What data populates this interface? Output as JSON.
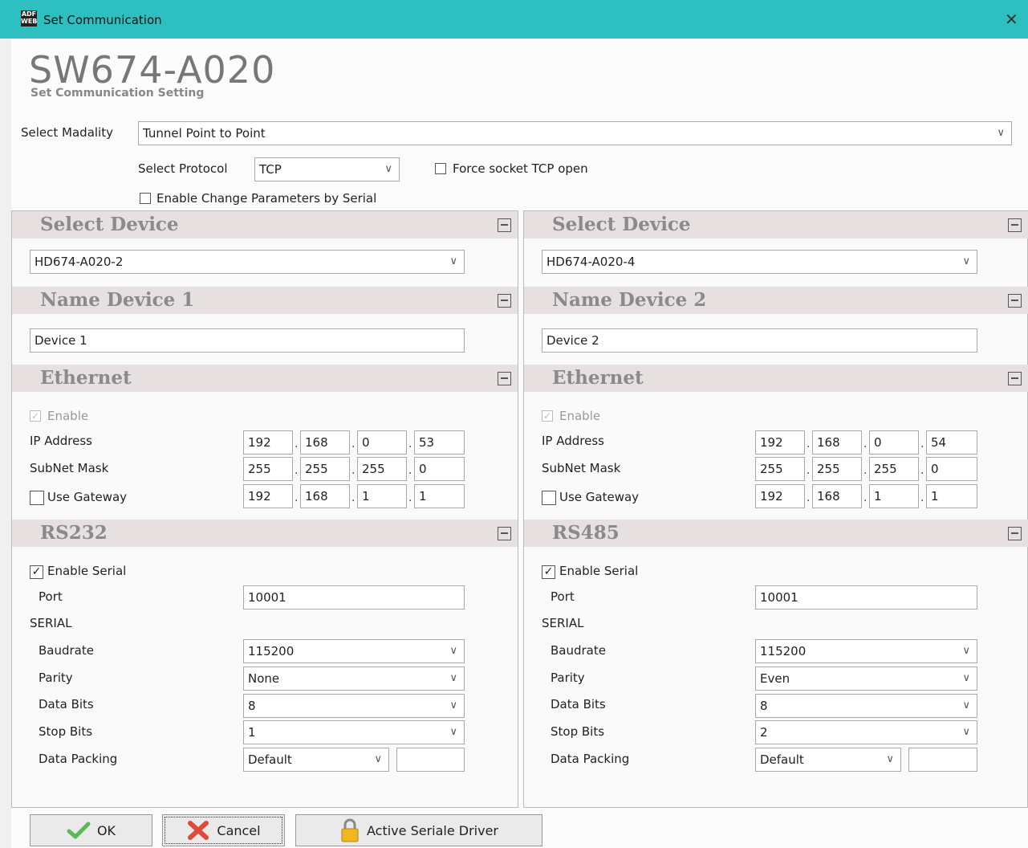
{
  "window": {
    "title": "Set Communication",
    "logo_text": "ADF WEB"
  },
  "header": {
    "title": "SW674-A020",
    "subtitle": "Set Communication Setting"
  },
  "modality": {
    "label": "Select Madality",
    "value": "Tunnel Point to Point"
  },
  "protocol": {
    "label": "Select Protocol",
    "value": "TCP",
    "force_label": "Force socket TCP open",
    "enable_change_label": "Enable Change Parameters by Serial"
  },
  "left": {
    "select_device": {
      "title": "Select Device",
      "value": "HD674-A020-2"
    },
    "name_device": {
      "title": "Name Device 1",
      "value": "Device 1"
    },
    "ethernet": {
      "title": "Ethernet",
      "enable_label": "Enable",
      "ip_label": "IP Address",
      "ip": [
        "192",
        "168",
        "0",
        "53"
      ],
      "mask_label": "SubNet Mask",
      "mask": [
        "255",
        "255",
        "255",
        "0"
      ],
      "gw_label": "Use Gateway",
      "gw": [
        "192",
        "168",
        "1",
        "1"
      ]
    },
    "serial_section": {
      "title": "RS232",
      "enable_serial_label": "Enable Serial",
      "port_label": "Port",
      "port": "10001",
      "serial_label": "SERIAL",
      "baud_label": "Baudrate",
      "baud": "115200",
      "parity_label": "Parity",
      "parity": "None",
      "databits_label": "Data Bits",
      "databits": "8",
      "stopbits_label": "Stop Bits",
      "stopbits": "1",
      "packing_label": "Data Packing",
      "packing": "Default",
      "packing_extra": ""
    }
  },
  "right": {
    "select_device": {
      "title": "Select Device",
      "value": "HD674-A020-4"
    },
    "name_device": {
      "title": "Name Device 2",
      "value": "Device 2"
    },
    "ethernet": {
      "title": "Ethernet",
      "enable_label": "Enable",
      "ip_label": "IP Address",
      "ip": [
        "192",
        "168",
        "0",
        "54"
      ],
      "mask_label": "SubNet Mask",
      "mask": [
        "255",
        "255",
        "255",
        "0"
      ],
      "gw_label": "Use Gateway",
      "gw": [
        "192",
        "168",
        "1",
        "1"
      ]
    },
    "serial_section": {
      "title": "RS485",
      "enable_serial_label": "Enable Serial",
      "port_label": "Port",
      "port": "10001",
      "serial_label": "SERIAL",
      "baud_label": "Baudrate",
      "baud": "115200",
      "parity_label": "Parity",
      "parity": "Even",
      "databits_label": "Data Bits",
      "databits": "8",
      "stopbits_label": "Stop Bits",
      "stopbits": "2",
      "packing_label": "Data Packing",
      "packing": "Default",
      "packing_extra": ""
    }
  },
  "buttons": {
    "ok": "OK",
    "cancel": "Cancel",
    "driver": "Active Seriale Driver"
  },
  "icons": {
    "ok": "checkmark-icon",
    "cancel": "x-icon",
    "driver": "padlock-icon"
  },
  "colors": {
    "titlebar": "#2ec0c0",
    "section_header": "#e6e0e0"
  }
}
